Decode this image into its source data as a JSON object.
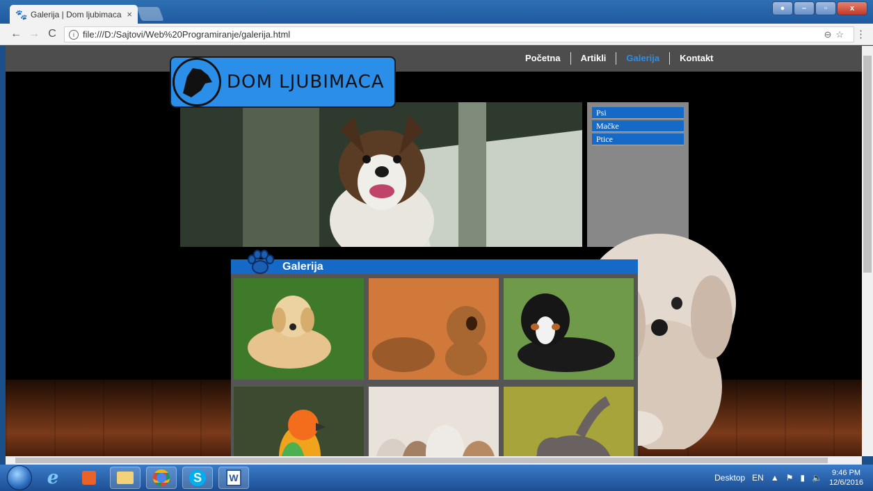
{
  "browser": {
    "tab_title": "Galerija | Dom ljubimaca",
    "tab_close": "×",
    "url": "file:///D:/Sajtovi/Web%20Programiranje/galerija.html",
    "nav": {
      "back": "←",
      "forward": "→",
      "reload": "C"
    },
    "address_right_icons": "⊖☆",
    "menu": "⋮"
  },
  "site": {
    "logo_text": "DOM LJUBIMACA",
    "nav_items": [
      {
        "label": "Početna"
      },
      {
        "label": "Artikli"
      },
      {
        "label": "Galerija",
        "active": true
      },
      {
        "label": "Kontakt"
      }
    ],
    "side_menu": [
      "Psi",
      "Mačke",
      "Ptice"
    ],
    "gallery_title": "Galerija",
    "accent_color": "#1569c7",
    "active_nav_color": "#2a8fe8"
  },
  "gallery_photos": [
    {
      "subject": "golden-retriever-puppy"
    },
    {
      "subject": "shar-pei-puppies"
    },
    {
      "subject": "bernese-puppy"
    },
    {
      "subject": "parrot"
    },
    {
      "subject": "kittens"
    },
    {
      "subject": "cat"
    }
  ],
  "taskbar": {
    "apps": [
      "start",
      "internet-explorer",
      "media-player",
      "file-explorer",
      "chrome",
      "skype",
      "word"
    ],
    "desktop_label": "Desktop",
    "language": "EN",
    "time": "9:46 PM",
    "date": "12/6/2016"
  }
}
